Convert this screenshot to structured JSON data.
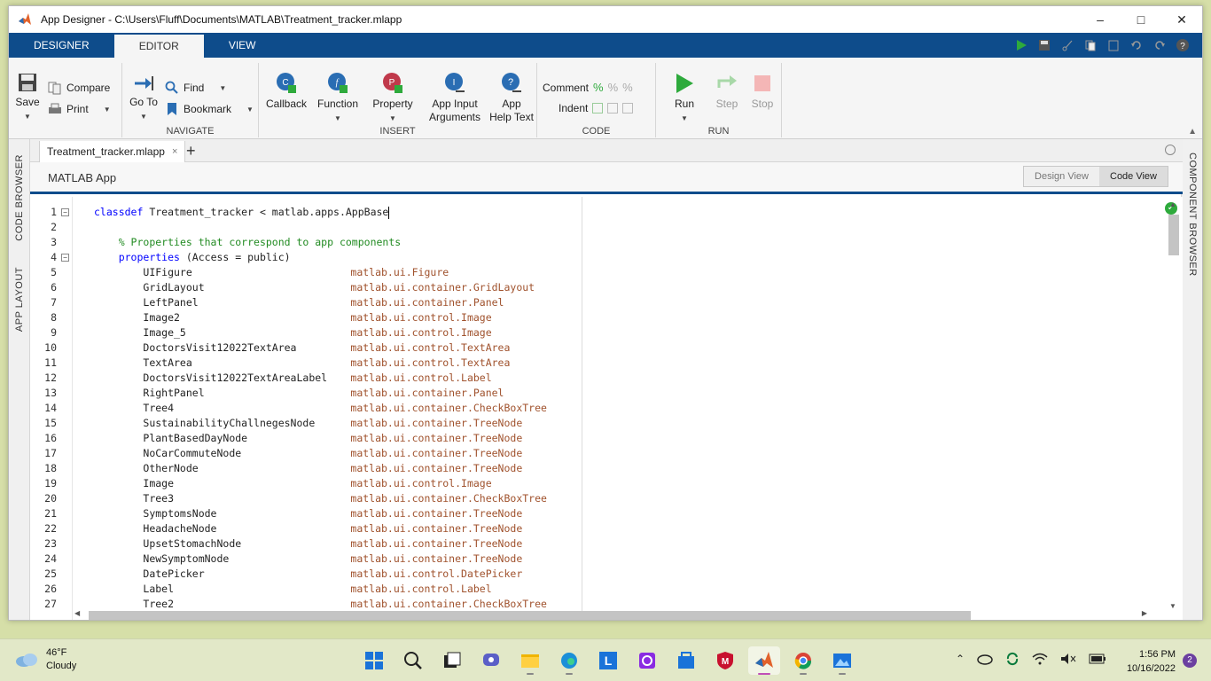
{
  "window": {
    "title": "App Designer - C:\\Users\\Fluff\\Documents\\MATLAB\\Treatment_tracker.mlapp"
  },
  "ribbon_tabs": [
    {
      "label": "DESIGNER"
    },
    {
      "label": "EDITOR"
    },
    {
      "label": "VIEW"
    }
  ],
  "ribbon": {
    "save": "Save",
    "compare": "Compare",
    "print": "Print",
    "file_group": "",
    "goto": "Go To",
    "find": "Find",
    "bookmark": "Bookmark",
    "navigate_group": "NAVIGATE",
    "callback": "Callback",
    "function": "Function",
    "property": "Property",
    "app_input_1": "App Input",
    "app_input_2": "Arguments",
    "app_help_1": "App",
    "app_help_2": "Help Text",
    "insert_group": "INSERT",
    "comment": "Comment",
    "indent": "Indent",
    "code_group": "CODE",
    "run": "Run",
    "step": "Step",
    "stop": "Stop",
    "run_group": "RUN"
  },
  "side_tabs": {
    "code_browser": "CODE BROWSER",
    "app_layout": "APP LAYOUT",
    "component_browser": "COMPONENT BROWSER"
  },
  "doc_tab": {
    "name": "Treatment_tracker.mlapp",
    "close": "×",
    "add": "+"
  },
  "view_bar": {
    "app_title": "MATLAB App",
    "design_view": "Design View",
    "code_view": "Code View"
  },
  "code": {
    "lines": [
      {
        "n": "1",
        "indent": "",
        "kw": "classdef",
        "text": " Treatment_tracker < matlab.apps.AppBase",
        "type": "",
        "fold": true
      },
      {
        "n": "2",
        "indent": "",
        "kw": "",
        "text": "",
        "type": "",
        "fold": false
      },
      {
        "n": "3",
        "indent": "    ",
        "kw": "",
        "comment": "% Properties that correspond to app components",
        "text": "",
        "type": "",
        "fold": false
      },
      {
        "n": "4",
        "indent": "    ",
        "kw": "properties",
        "text": " (Access = public)",
        "type": "",
        "fold": true
      },
      {
        "n": "5",
        "indent": "        ",
        "kw": "",
        "text": "UIFigure",
        "type": "matlab.ui.Figure",
        "fold": false
      },
      {
        "n": "6",
        "indent": "        ",
        "kw": "",
        "text": "GridLayout",
        "type": "matlab.ui.container.GridLayout",
        "fold": false
      },
      {
        "n": "7",
        "indent": "        ",
        "kw": "",
        "text": "LeftPanel",
        "type": "matlab.ui.container.Panel",
        "fold": false
      },
      {
        "n": "8",
        "indent": "        ",
        "kw": "",
        "text": "Image2",
        "type": "matlab.ui.control.Image",
        "fold": false
      },
      {
        "n": "9",
        "indent": "        ",
        "kw": "",
        "text": "Image_5",
        "type": "matlab.ui.control.Image",
        "fold": false
      },
      {
        "n": "10",
        "indent": "        ",
        "kw": "",
        "text": "DoctorsVisit12022TextArea",
        "type": "matlab.ui.control.TextArea",
        "fold": false
      },
      {
        "n": "11",
        "indent": "        ",
        "kw": "",
        "text": "TextArea",
        "type": "matlab.ui.control.TextArea",
        "fold": false
      },
      {
        "n": "12",
        "indent": "        ",
        "kw": "",
        "text": "DoctorsVisit12022TextAreaLabel",
        "type": "matlab.ui.control.Label",
        "fold": false
      },
      {
        "n": "13",
        "indent": "        ",
        "kw": "",
        "text": "RightPanel",
        "type": "matlab.ui.container.Panel",
        "fold": false
      },
      {
        "n": "14",
        "indent": "        ",
        "kw": "",
        "text": "Tree4",
        "type": "matlab.ui.container.CheckBoxTree",
        "fold": false
      },
      {
        "n": "15",
        "indent": "        ",
        "kw": "",
        "text": "SustainabilityChallnegesNode",
        "type": "matlab.ui.container.TreeNode",
        "fold": false
      },
      {
        "n": "16",
        "indent": "        ",
        "kw": "",
        "text": "PlantBasedDayNode",
        "type": "matlab.ui.container.TreeNode",
        "fold": false
      },
      {
        "n": "17",
        "indent": "        ",
        "kw": "",
        "text": "NoCarCommuteNode",
        "type": "matlab.ui.container.TreeNode",
        "fold": false
      },
      {
        "n": "18",
        "indent": "        ",
        "kw": "",
        "text": "OtherNode",
        "type": "matlab.ui.container.TreeNode",
        "fold": false
      },
      {
        "n": "19",
        "indent": "        ",
        "kw": "",
        "text": "Image",
        "type": "matlab.ui.control.Image",
        "fold": false
      },
      {
        "n": "20",
        "indent": "        ",
        "kw": "",
        "text": "Tree3",
        "type": "matlab.ui.container.CheckBoxTree",
        "fold": false
      },
      {
        "n": "21",
        "indent": "        ",
        "kw": "",
        "text": "SymptomsNode",
        "type": "matlab.ui.container.TreeNode",
        "fold": false
      },
      {
        "n": "22",
        "indent": "        ",
        "kw": "",
        "text": "HeadacheNode",
        "type": "matlab.ui.container.TreeNode",
        "fold": false
      },
      {
        "n": "23",
        "indent": "        ",
        "kw": "",
        "text": "UpsetStomachNode",
        "type": "matlab.ui.container.TreeNode",
        "fold": false
      },
      {
        "n": "24",
        "indent": "        ",
        "kw": "",
        "text": "NewSymptomNode",
        "type": "matlab.ui.container.TreeNode",
        "fold": false
      },
      {
        "n": "25",
        "indent": "        ",
        "kw": "",
        "text": "DatePicker",
        "type": "matlab.ui.control.DatePicker",
        "fold": false
      },
      {
        "n": "26",
        "indent": "        ",
        "kw": "",
        "text": "Label",
        "type": "matlab.ui.control.Label",
        "fold": false
      },
      {
        "n": "27",
        "indent": "        ",
        "kw": "",
        "text": "Tree2",
        "type": "matlab.ui.container.CheckBoxTree",
        "fold": false
      }
    ]
  },
  "taskbar": {
    "temperature": "46°F",
    "condition": "Cloudy",
    "time": "1:56 PM",
    "date": "10/16/2022",
    "notifications": "2"
  },
  "colors": {
    "ribbon_blue": "#0e4c8b",
    "keyword": "#0000ff",
    "comment": "#228b22",
    "type": "#a0522d"
  }
}
